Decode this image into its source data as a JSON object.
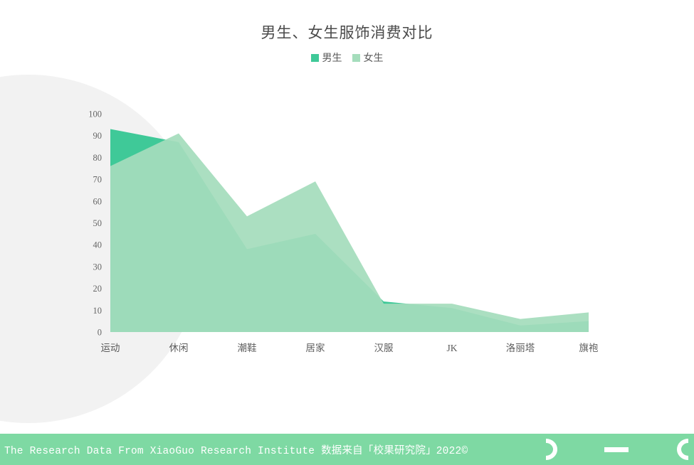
{
  "chart_data": {
    "type": "area",
    "title": "男生、女生服饰消费对比",
    "xlabel": "",
    "ylabel": "",
    "ylim": [
      0,
      100
    ],
    "ytick_values": [
      0,
      10,
      20,
      30,
      40,
      50,
      60,
      70,
      80,
      90,
      100
    ],
    "ytick_labels": [
      "0",
      "10",
      "20",
      "30",
      "40",
      "50",
      "60",
      "70",
      "80",
      "90",
      "100"
    ],
    "grid": false,
    "legend_position": "top-center",
    "categories": [
      "运动",
      "休闲",
      "潮鞋",
      "居家",
      "汉服",
      "JK",
      "洛丽塔",
      "旗袍"
    ],
    "series": [
      {
        "name": "男生",
        "color": "#3fc998",
        "values": [
          93,
          87,
          38,
          45,
          14,
          11,
          3,
          5
        ]
      },
      {
        "name": "女生",
        "color": "#a5ddbc",
        "values": [
          76,
          91,
          53,
          69,
          13,
          13,
          6,
          9
        ]
      }
    ]
  },
  "legend": {
    "items": [
      {
        "label": "男生",
        "color": "#3fc998"
      },
      {
        "label": "女生",
        "color": "#a5ddbc"
      }
    ]
  },
  "footer": {
    "text": "The Research Data  From XiaoGuo Research Institute 数据来自「校果研究院」2022©",
    "background_color": "#7ed9a3",
    "marks": [
      "arc-right-glyph",
      "dash-glyph",
      "arc-left-glyph"
    ]
  },
  "theme": {
    "background": "#ffffff",
    "decoration_circle": "#f2f2f2",
    "title_color": "#4a4a4a",
    "tick_color": "#666666"
  }
}
